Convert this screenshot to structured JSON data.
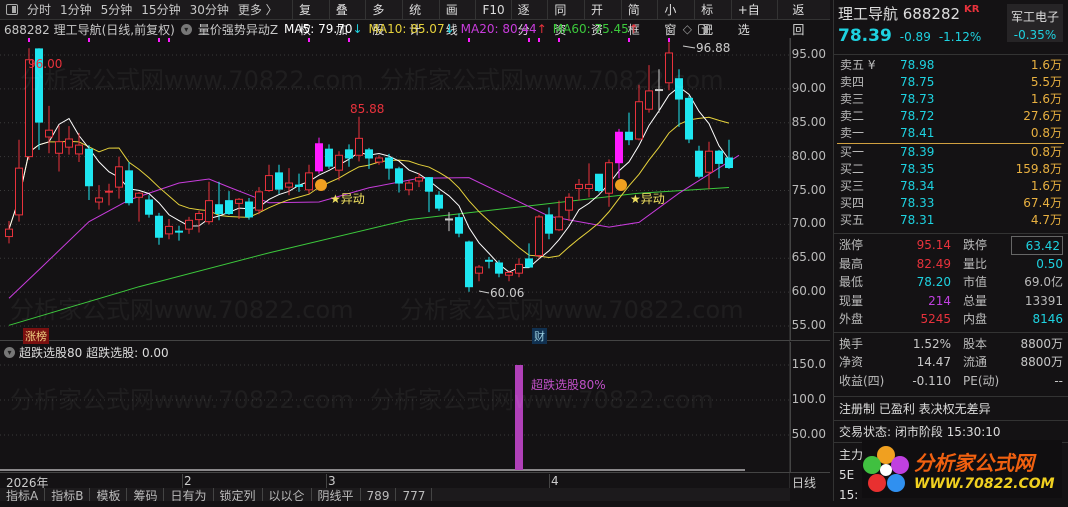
{
  "toolbar": {
    "left": [
      "分时",
      "1分钟",
      "5分钟",
      "15分钟",
      "30分钟",
      "更多 〉"
    ],
    "buttons": [
      "复权",
      "叠加",
      "多股",
      "统计",
      "画线",
      "F10",
      "逐分",
      "同资",
      "开资",
      "简框",
      "小窗",
      "标记",
      "+自选",
      "返回"
    ]
  },
  "title": {
    "code_name": "688282 理工导航(日线,前复权)",
    "indicator": "量价强势异动Z",
    "ma5": "MA5: 79.70",
    "ma10": "MA10: 85.07",
    "ma20": "MA20: 80.44",
    "ma60": "MA60: 75.45",
    "ma5_arrow": "↓",
    "ma10_arrow": "↓",
    "ma20_arrow": "↑",
    "ma60_arrow": "↑"
  },
  "colors": {
    "up": "#e8323c",
    "down": "#1ee6f0",
    "limit": "#ff1aff",
    "ma5": "#ffffff",
    "ma10": "#e6d23c",
    "ma20": "#c83cdc",
    "ma60": "#3cc83c"
  },
  "chart_data": [
    {
      "type": "candlestick",
      "title": "688282 理工导航(日线,前复权)",
      "ylim": [
        53,
        97
      ],
      "yticks": [
        "95.00",
        "90.00",
        "85.00",
        "80.00",
        "75.00",
        "70.00",
        "65.00",
        "60.00",
        "55.00"
      ],
      "ytick_values": [
        95,
        90,
        85,
        80,
        75,
        70,
        65,
        60,
        55
      ],
      "ohlc": [
        [
          68.2,
          70.5,
          67.2,
          69.3
        ],
        [
          71.4,
          82.5,
          70.4,
          78.3
        ],
        [
          80,
          96,
          79.5,
          94.3
        ],
        [
          95.9,
          96,
          81,
          85.1
        ],
        [
          82.9,
          87.5,
          80.5,
          83.9
        ],
        [
          80.5,
          84.6,
          77.8,
          82.2
        ],
        [
          81.4,
          84.5,
          80.3,
          82.6
        ],
        [
          80.4,
          83.5,
          79.2,
          81.7
        ],
        [
          81.1,
          81.7,
          73.6,
          75.7
        ],
        [
          73.3,
          75.8,
          72.2,
          73.9
        ],
        [
          74.8,
          76,
          72.8,
          74.9
        ],
        [
          75.5,
          80,
          73.8,
          78.5
        ],
        [
          77.9,
          79.2,
          72.8,
          73.2
        ],
        [
          74,
          74.8,
          70.4,
          74.6
        ],
        [
          73.6,
          74.3,
          71,
          71.5
        ],
        [
          71.2,
          71.7,
          67,
          68.1
        ],
        [
          68.6,
          70.8,
          67.8,
          69.7
        ],
        [
          69,
          69.8,
          67.6,
          68.9
        ],
        [
          69.3,
          71.1,
          68.6,
          70.6
        ],
        [
          70.7,
          72,
          68.8,
          71.6
        ],
        [
          70.4,
          76.3,
          70,
          73.5
        ],
        [
          72.9,
          76.3,
          70.6,
          71.6
        ],
        [
          73.5,
          74.9,
          71.4,
          71.6
        ],
        [
          73.1,
          73.9,
          70.8,
          73.7
        ],
        [
          73.3,
          73.9,
          70.7,
          71.1
        ],
        [
          72.1,
          75.5,
          71.5,
          74.8
        ],
        [
          75,
          78.8,
          74.8,
          77.2
        ],
        [
          77.6,
          78.8,
          74.5,
          75.2
        ],
        [
          75.5,
          78.3,
          74.3,
          76.1
        ],
        [
          75.8,
          77.5,
          74.8,
          75.6
        ],
        [
          75.1,
          78.8,
          74.5,
          77.6
        ],
        [
          77.9,
          82.8,
          77.5,
          81.9
        ],
        [
          81.1,
          81.8,
          78.2,
          78.6
        ],
        [
          78,
          80.8,
          76.5,
          80.2
        ],
        [
          81,
          81.8,
          78.5,
          79.8
        ],
        [
          80.2,
          85.88,
          79.3,
          82.7
        ],
        [
          81,
          81.3,
          78.2,
          79.8
        ],
        [
          79.2,
          80.2,
          78.8,
          79.8
        ],
        [
          79.8,
          80.4,
          76.6,
          78.3
        ],
        [
          78.2,
          78.5,
          74.7,
          76.1
        ],
        [
          75.1,
          76.5,
          74.3,
          76.1
        ],
        [
          76.4,
          77.6,
          75.5,
          76.9
        ],
        [
          76.9,
          77,
          71.8,
          74.9
        ],
        [
          74.3,
          74.9,
          72,
          72.4
        ],
        [
          70.8,
          71.8,
          69,
          70.8
        ],
        [
          71,
          71.6,
          68.1,
          68.7
        ],
        [
          67.4,
          67.6,
          60.06,
          60.8
        ],
        [
          62.8,
          64,
          61.6,
          63.7
        ],
        [
          64.7,
          65.2,
          63.5,
          64.6
        ],
        [
          64.3,
          64.7,
          62.2,
          62.8
        ],
        [
          62.5,
          63.2,
          61.6,
          62.9
        ],
        [
          62.8,
          65,
          62.2,
          64.1
        ],
        [
          64.9,
          67.2,
          63.7,
          63.7
        ],
        [
          65.4,
          71.4,
          65,
          71.1
        ],
        [
          71.4,
          72.5,
          67.8,
          68.7
        ],
        [
          69.2,
          73.5,
          69,
          71.1
        ],
        [
          72.1,
          74.6,
          70.5,
          74
        ],
        [
          75.3,
          76.7,
          73.5,
          75.9
        ],
        [
          75.3,
          79,
          74,
          75.9
        ],
        [
          77.4,
          77.4,
          74.7,
          75
        ],
        [
          74.6,
          79.6,
          72.6,
          79.1
        ],
        [
          79.1,
          84.1,
          76.8,
          83.6
        ],
        [
          83.6,
          86.5,
          81.7,
          82.5
        ],
        [
          82.6,
          90.6,
          82.4,
          88.1
        ],
        [
          87,
          93.5,
          86.5,
          89.7
        ],
        [
          89.9,
          92.9,
          86.5,
          89.9
        ],
        [
          90.9,
          96.88,
          89.8,
          95.3
        ],
        [
          91.5,
          92.9,
          84.4,
          88.5
        ],
        [
          88.6,
          89,
          82,
          82.6
        ],
        [
          80.8,
          81.6,
          76.8,
          77.1
        ],
        [
          77.7,
          82.2,
          75.2,
          80.8
        ],
        [
          80.8,
          81,
          76.8,
          79
        ],
        [
          79.8,
          82.49,
          78.2,
          78.39
        ]
      ],
      "limit_up_indices": [
        31,
        61
      ],
      "ma20_points": [
        [
          0,
          59.1
        ],
        [
          3,
          63.3
        ],
        [
          8,
          70.4
        ],
        [
          12,
          73.6
        ],
        [
          17,
          76.1
        ],
        [
          20,
          76.7
        ],
        [
          22,
          75.5
        ],
        [
          26,
          73.2
        ],
        [
          31,
          73.3
        ],
        [
          36,
          75.4
        ],
        [
          41,
          76.8
        ],
        [
          46,
          76.9
        ],
        [
          54,
          71.2
        ],
        [
          60,
          69.6
        ],
        [
          63,
          70.3
        ],
        [
          67,
          74.6
        ],
        [
          73,
          80.2
        ]
      ],
      "ma60_points": [
        [
          0,
          55.1
        ],
        [
          13,
          60.8
        ],
        [
          26,
          65.8
        ],
        [
          40,
          70.7
        ],
        [
          53,
          72.9
        ],
        [
          63,
          74.6
        ],
        [
          72,
          75.45
        ]
      ],
      "signal_indices": [
        30,
        60
      ],
      "signal_label": "★异动",
      "top_marker_indices": [
        2,
        8,
        15,
        16,
        30,
        34,
        46,
        52,
        53,
        55,
        62,
        66
      ],
      "annotations": {
        "high1": "96.00",
        "high2": "85.88",
        "high3": "96.88",
        "low1": "60.06"
      },
      "tags": {
        "zhangbang": "涨榜",
        "cai": "财"
      }
    },
    {
      "type": "bar",
      "title": "超跌选股80",
      "header": "超跌选股80  超跌选股: 0.00",
      "ylim": [
        0,
        160
      ],
      "yticks": [
        "150.0",
        "100.0",
        "50.00"
      ],
      "ytick_values": [
        150,
        100,
        50
      ],
      "bars": [
        {
          "index": 51,
          "value": 150
        }
      ],
      "bar_label": "超跌选股80%"
    }
  ],
  "xaxis": {
    "labels": [
      "2026年",
      "2",
      "3",
      "4"
    ],
    "period": "日线"
  },
  "bottom_tabs": [
    "指标A",
    "指标B",
    "模板",
    "筹码",
    "日有为",
    "锁定列",
    "以以仑",
    "阴线平",
    "789",
    "777"
  ],
  "watermark": "分析家公式网www.70822.com",
  "right": {
    "name_code": "理工导航 688282",
    "kr": "KR",
    "sector": "军工电子",
    "sector_pct": "-0.35%",
    "price": "78.39",
    "change": "-0.89",
    "pct": "-1.12%",
    "asks": [
      {
        "l": "卖五 ¥",
        "p": "78.98",
        "v": "1.6万"
      },
      {
        "l": "卖四",
        "p": "78.75",
        "v": "5.5万"
      },
      {
        "l": "卖三",
        "p": "78.73",
        "v": "1.6万"
      },
      {
        "l": "卖二",
        "p": "78.72",
        "v": "27.6万"
      },
      {
        "l": "卖一",
        "p": "78.41",
        "v": "0.8万"
      }
    ],
    "bids": [
      {
        "l": "买一",
        "p": "78.39",
        "v": "0.8万"
      },
      {
        "l": "买二",
        "p": "78.35",
        "v": "159.8万"
      },
      {
        "l": "买三",
        "p": "78.34",
        "v": "1.6万"
      },
      {
        "l": "买四",
        "p": "78.33",
        "v": "67.4万"
      },
      {
        "l": "买五",
        "p": "78.31",
        "v": "4.7万"
      }
    ],
    "stats": [
      [
        "涨停",
        "95.14",
        "red",
        "跌停",
        "63.42",
        "cyan"
      ],
      [
        "最高",
        "82.49",
        "red",
        "量比",
        "0.50",
        "cyan"
      ],
      [
        "最低",
        "78.20",
        "cyan",
        "市值",
        "69.0亿",
        "gray"
      ],
      [
        "现量",
        "214",
        "mag",
        "总量",
        "13391",
        "gray"
      ],
      [
        "外盘",
        "5245",
        "red",
        "内盘",
        "8146",
        "cyan"
      ]
    ],
    "stats2": [
      [
        "换手",
        "1.52%",
        "股本",
        "8800万"
      ],
      [
        "净资",
        "14.47",
        "流通",
        "8800万"
      ],
      [
        "收益(四)",
        "-0.110",
        "PE(动)",
        "--"
      ]
    ],
    "tags_line": "注册制 已盈利 表决权无差异",
    "status_line": "交易状态: 闭市阶段 15:30:10",
    "partial": [
      "主力",
      "5E",
      "15:"
    ],
    "logo_cn": "分析家公式网",
    "logo_url": "WWW.70822.COM"
  }
}
